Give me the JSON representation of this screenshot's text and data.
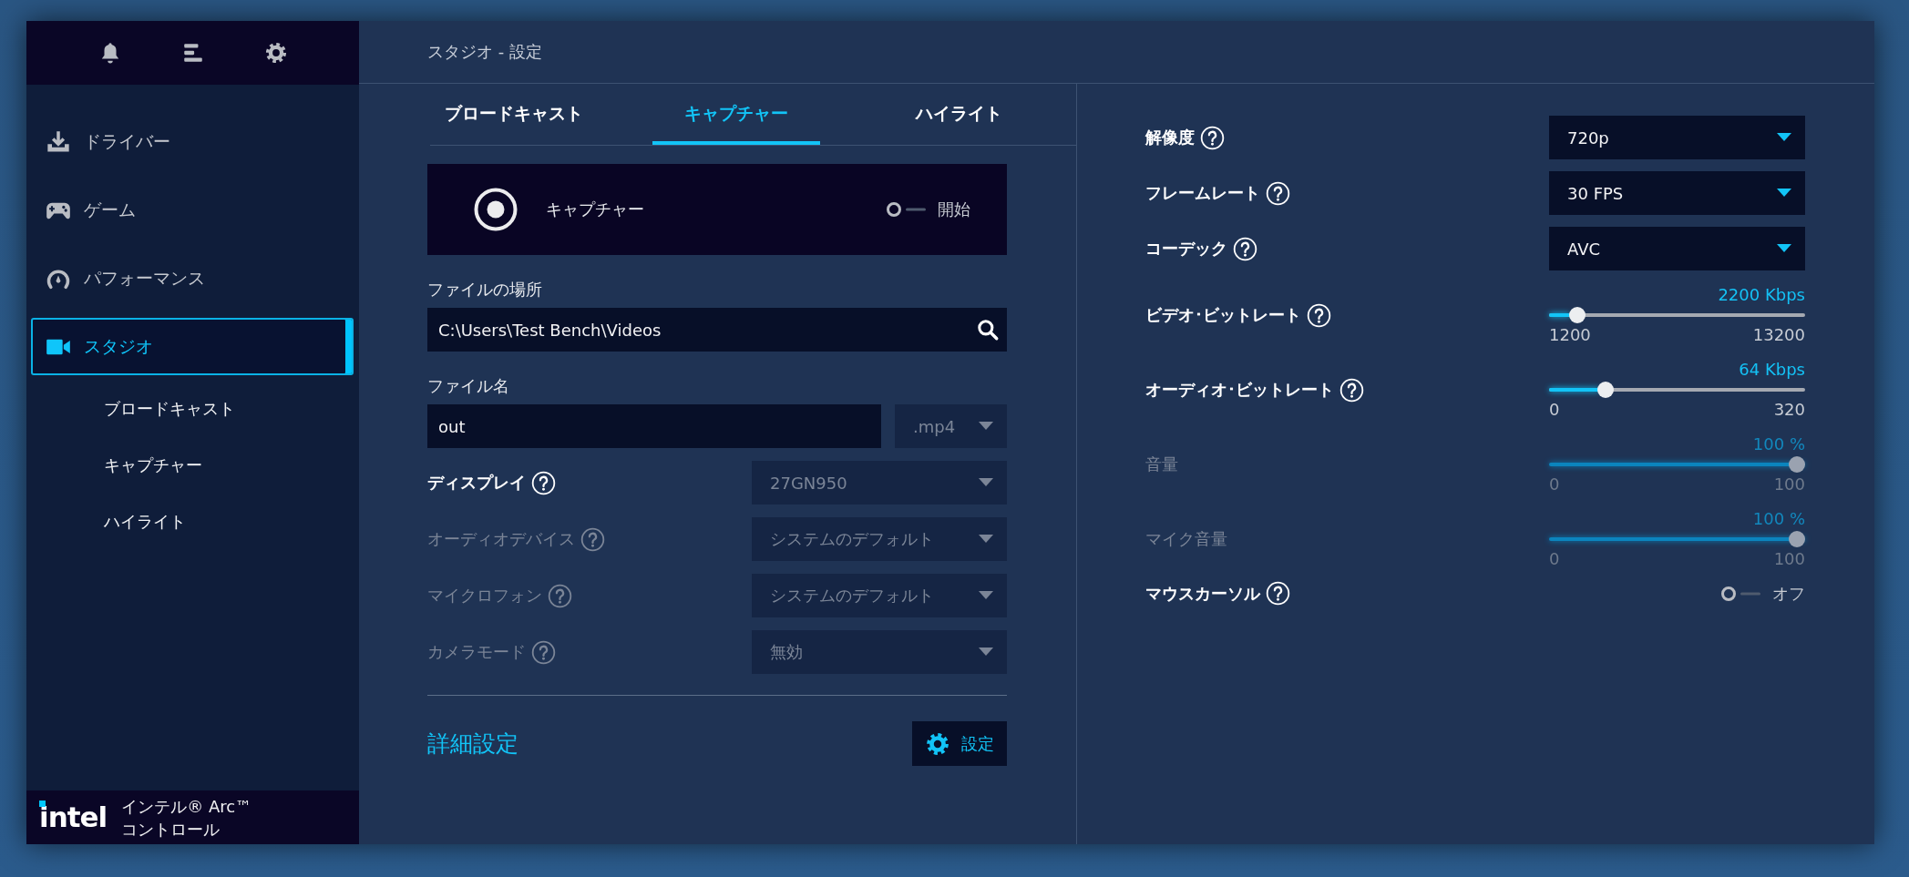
{
  "sidebar": {
    "nav": [
      {
        "label": "ドライバー",
        "kind": "download",
        "selected": false
      },
      {
        "label": "ゲーム",
        "kind": "gamepad",
        "selected": false
      },
      {
        "label": "パフォーマンス",
        "kind": "gauge",
        "selected": false
      },
      {
        "label": "スタジオ",
        "kind": "camera",
        "selected": true,
        "children": [
          {
            "label": "ブロードキャスト",
            "selected": false
          },
          {
            "label": "キャプチャー",
            "selected": false
          },
          {
            "label": "ハイライト",
            "selected": false
          }
        ]
      }
    ],
    "footer": {
      "logo": "intel",
      "product": "インテル® Arc™\nコントロール"
    }
  },
  "window": {
    "title": "スタジオ - 設定"
  },
  "tabs": [
    {
      "label": "ブロードキャスト",
      "selected": false
    },
    {
      "label": "キャプチャー",
      "selected": true
    },
    {
      "label": "ハイライト",
      "selected": false
    }
  ],
  "capture": {
    "label": "キャプチャー",
    "toggle": {
      "label": "開始",
      "on": false
    }
  },
  "file_location": {
    "label": "ファイルの場所",
    "value": "C:\\Users\\Test Bench\\Videos"
  },
  "file_name": {
    "label": "ファイル名",
    "value": "out",
    "extension": {
      "value": ".mp4",
      "disabled": true
    }
  },
  "devices": [
    {
      "label": "ディスプレイ",
      "help": true,
      "disabled": false,
      "select": {
        "value": "27GN950",
        "disabled": true
      }
    },
    {
      "label": "オーディオデバイス",
      "help": true,
      "disabled": true,
      "select": {
        "value": "システムのデフォルト",
        "disabled": true
      }
    },
    {
      "label": "マイクロフォン",
      "help": true,
      "disabled": true,
      "select": {
        "value": "システムのデフォルト",
        "disabled": true
      }
    },
    {
      "label": "カメラモード",
      "help": true,
      "disabled": true,
      "select": {
        "value": "無効",
        "disabled": true
      }
    }
  ],
  "advanced": {
    "label": "詳細設定",
    "button": "設定"
  },
  "settings": [
    {
      "kind": "select",
      "label": "解像度",
      "help": true,
      "disabled": false,
      "value": "720p"
    },
    {
      "kind": "select",
      "label": "フレームレート",
      "help": true,
      "disabled": false,
      "value": "30 FPS"
    },
    {
      "kind": "select",
      "label": "コーデック",
      "help": true,
      "disabled": false,
      "value": "AVC"
    },
    {
      "kind": "slider",
      "label": "ビデオ･ビットレート",
      "help": true,
      "disabled": false,
      "reading": "2200 Kbps",
      "level": 0.083,
      "min": "1200",
      "max": "13200"
    },
    {
      "kind": "slider",
      "label": "オーディオ･ビットレート",
      "help": true,
      "disabled": false,
      "reading": "64 Kbps",
      "level": 0.2,
      "min": "0",
      "max": "320"
    },
    {
      "kind": "slider",
      "label": "音量",
      "help": false,
      "disabled": true,
      "reading": "100 %",
      "level": 1,
      "min": "0",
      "max": "100"
    },
    {
      "kind": "slider",
      "label": "マイク音量",
      "help": false,
      "disabled": true,
      "reading": "100 %",
      "level": 1,
      "min": "0",
      "max": "100"
    },
    {
      "kind": "toggle",
      "label": "マウスカーソル",
      "help": true,
      "disabled": false,
      "value": "オフ",
      "on": false
    }
  ]
}
